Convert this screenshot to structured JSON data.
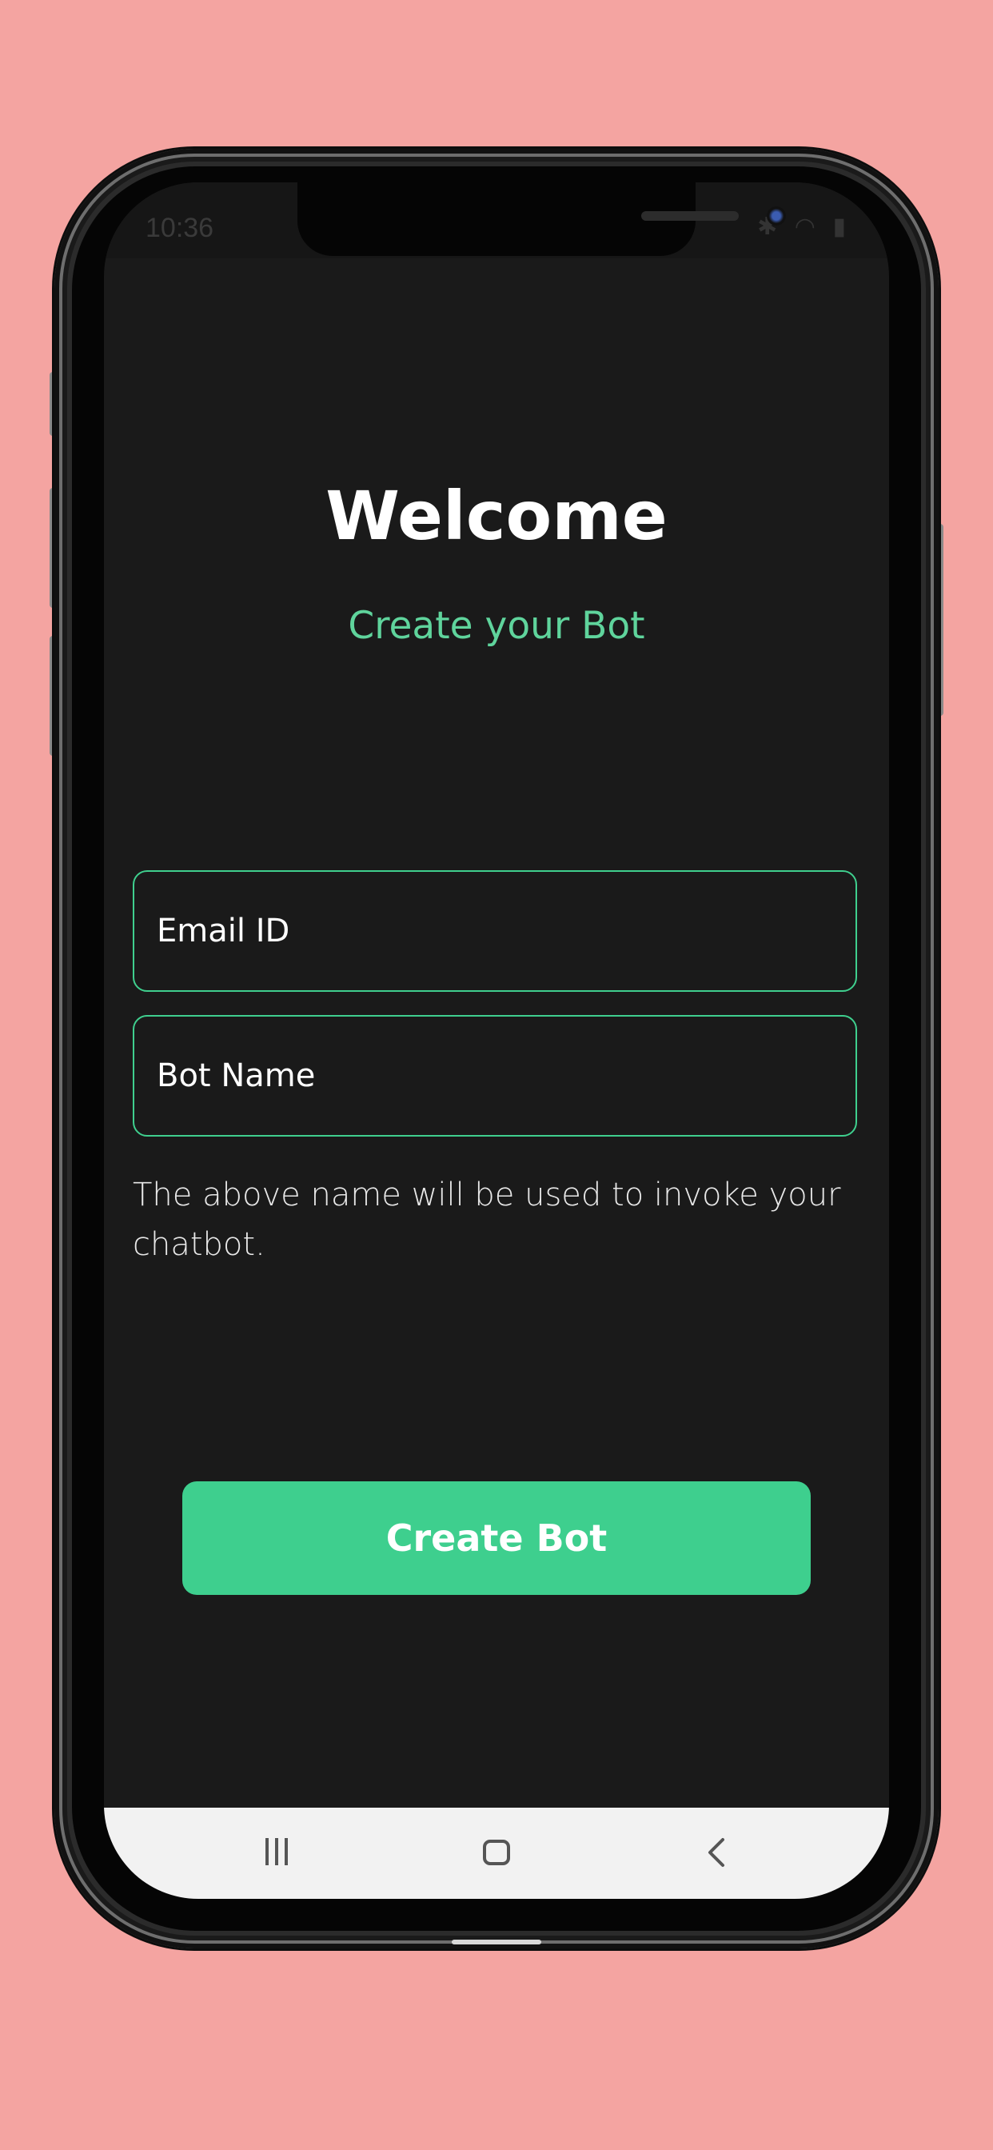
{
  "status_bar": {
    "time": "10:36",
    "left_icons": [
      "image-icon",
      "message-icon"
    ],
    "right_icons": [
      "bluetooth-icon",
      "wifi-icon",
      "call-icon",
      "signal-icon",
      "battery-icon"
    ]
  },
  "header": {
    "title": "Welcome",
    "subtitle": "Create your Bot"
  },
  "form": {
    "email": {
      "placeholder": "Email ID",
      "value": ""
    },
    "bot_name": {
      "placeholder": "Bot Name",
      "value": ""
    },
    "hint": "The above name will be used to invoke your chatbot."
  },
  "actions": {
    "create_label": "Create Bot"
  },
  "nav_bar": {
    "icons": [
      "recents-icon",
      "home-icon",
      "back-icon"
    ]
  },
  "colors": {
    "background": "#f4a4a1",
    "screen": "#1a1a1a",
    "accent": "#3ecf8e",
    "subtitle": "#5fd49c"
  }
}
